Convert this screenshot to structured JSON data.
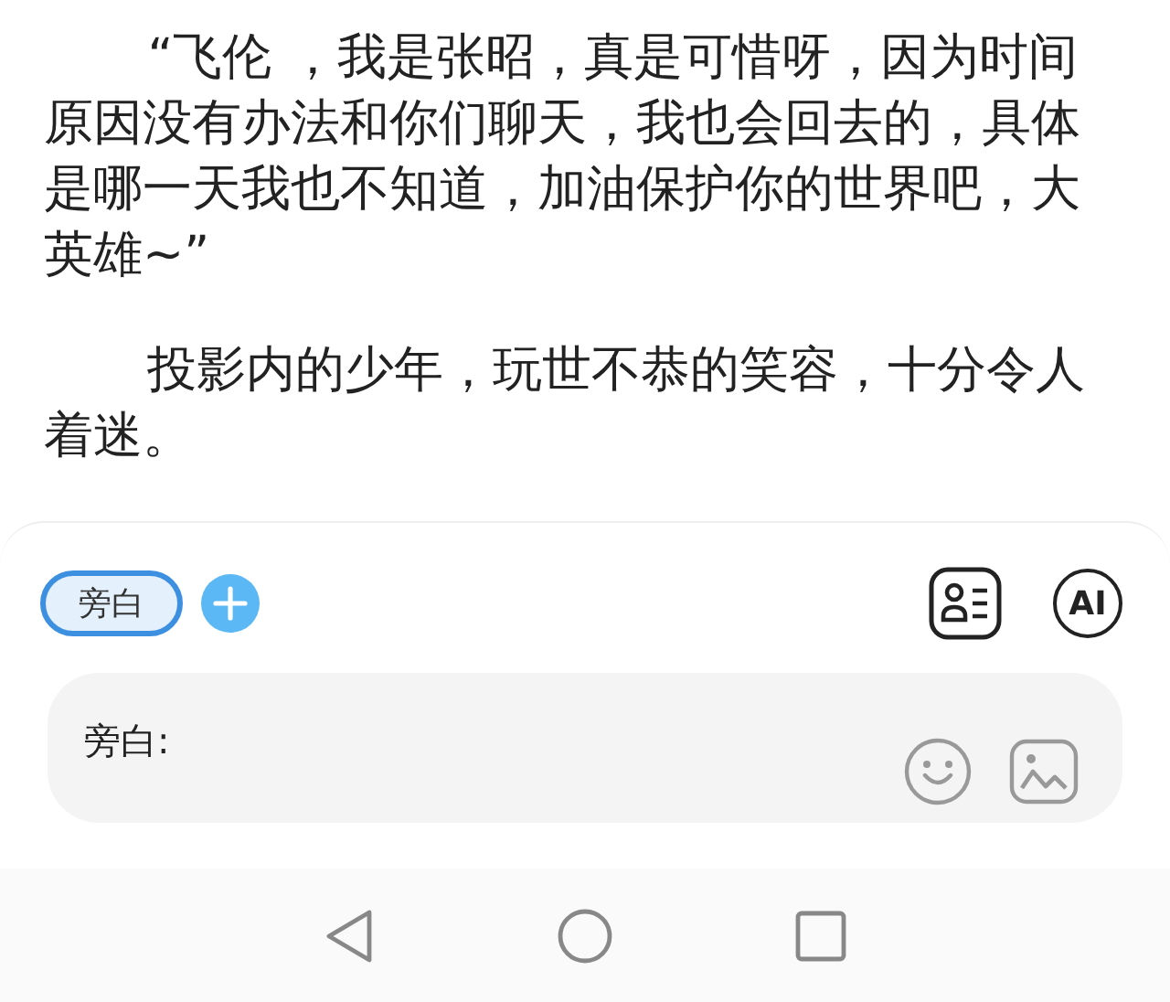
{
  "story": {
    "paragraphs": [
      "“飞伦 ，我是张昭，真是可惜呀，因为时间原因没有办法和你们聊天，我也会回去的，具体是哪一天我也不知道，加油保护你的世界吧，大英雄~”",
      "投影内的少年，玩世不恭的笑容，十分令人着迷。"
    ]
  },
  "editor": {
    "roles": [
      {
        "label": "旁白",
        "selected": true
      }
    ],
    "ai_button": "AI",
    "input": {
      "label": "旁白:"
    }
  }
}
